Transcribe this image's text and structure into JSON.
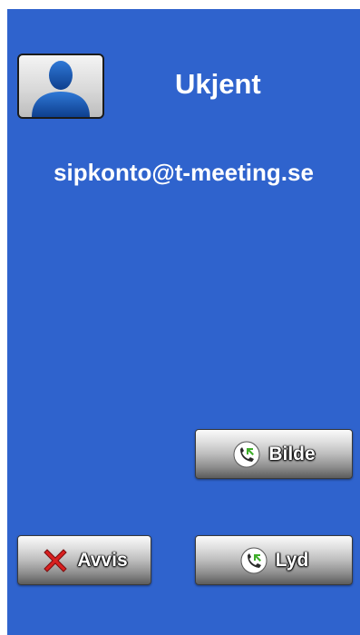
{
  "caller": {
    "name": "Ukjent",
    "address": "sipkonto@t-meeting.se",
    "avatar_icon": "default-user-avatar-icon"
  },
  "actions": {
    "video_label": "Bilde",
    "decline_label": "Avvis",
    "audio_label": "Lyd"
  },
  "icons": {
    "answer": "phone-answer-icon",
    "decline": "red-x-icon"
  },
  "colors": {
    "background": "#2f63cd",
    "text": "#ffffff",
    "decline_red": "#d92020",
    "answer_green": "#3fae2a"
  }
}
